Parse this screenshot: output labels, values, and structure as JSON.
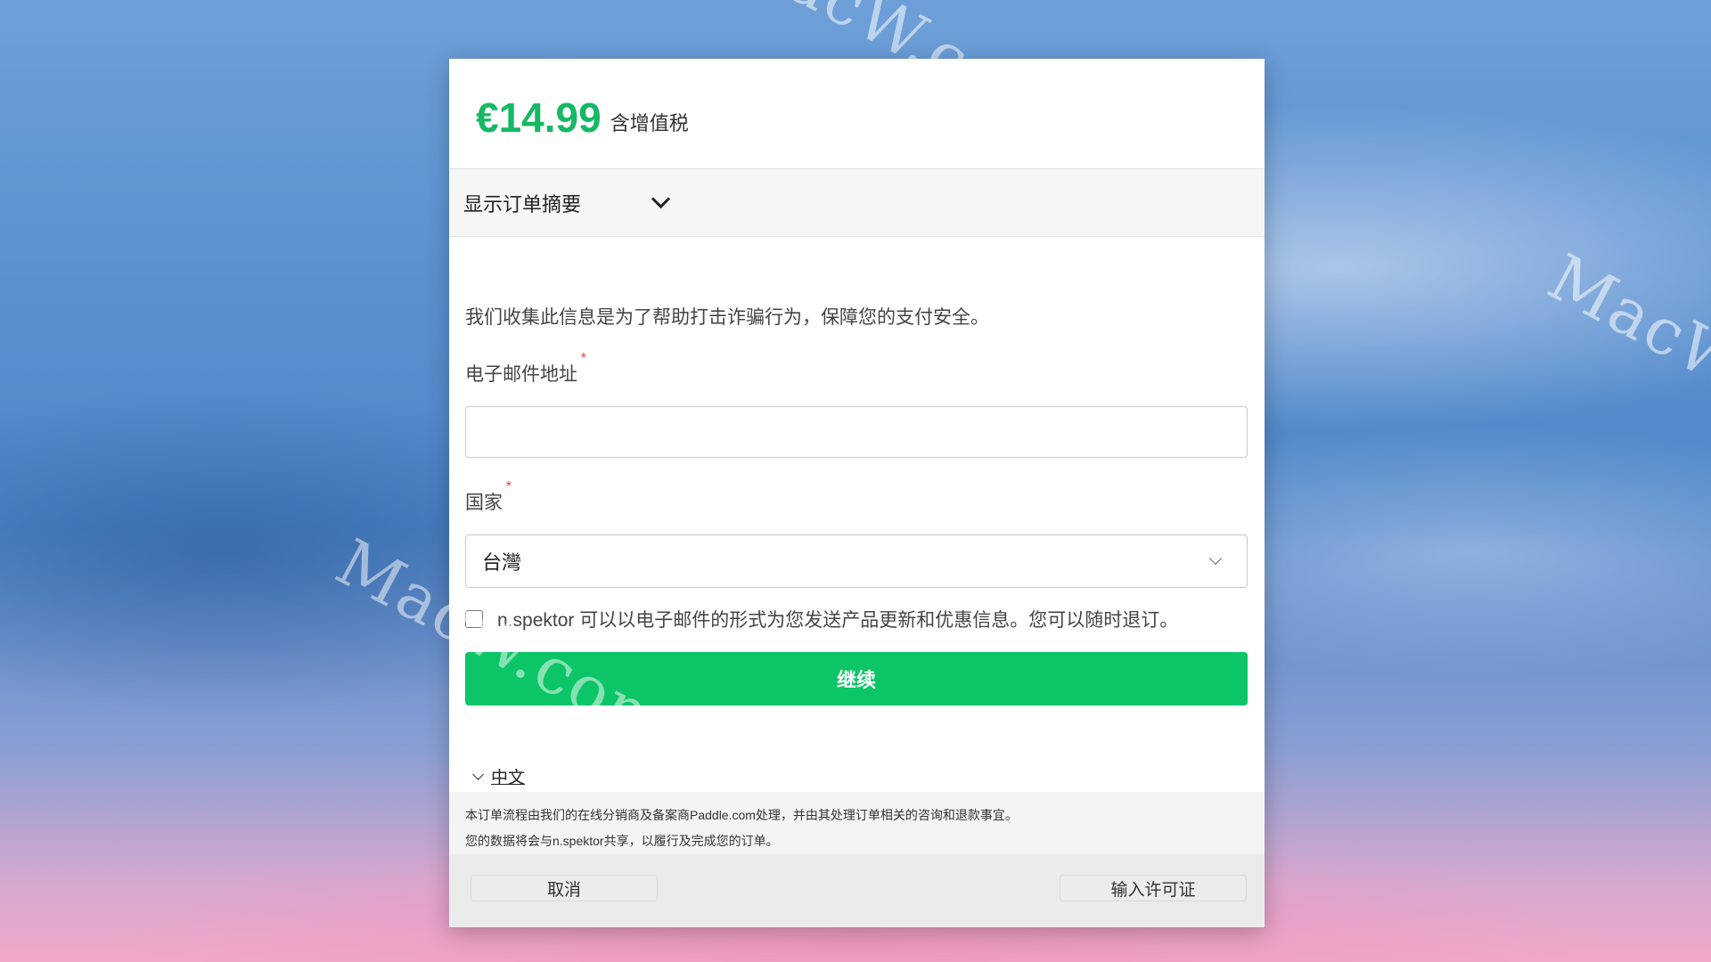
{
  "watermark": {
    "text": "MacW.com"
  },
  "price": {
    "amount": "€14.99",
    "vat_label": "含增值税"
  },
  "summary": {
    "label": "显示订单摘要"
  },
  "form": {
    "notice": "我们收集此信息是为了帮助打击诈骗行为，保障您的支付安全。",
    "email_label": "电子邮件地址",
    "email_value": "",
    "country_label": "国家",
    "country_value": "台灣",
    "required_mark": "*",
    "optin_text": "n.spektor 可以以电子邮件的形式为您发送产品更新和优惠信息。您可以随时退订。",
    "optin_checked": false,
    "continue_label": "继续"
  },
  "language": {
    "label": "中文"
  },
  "footer_note": {
    "line1": "本订单流程由我们的在线分销商及备案商Paddle.com处理，并由其处理订单相关的咨询和退款事宜。",
    "line2": "您的数据将会与n.spektor共享，以履行及完成您的订单。"
  },
  "bottom_bar": {
    "cancel_label": "取消",
    "license_label": "输入许可证"
  },
  "colors": {
    "accent": "#0cc567",
    "price": "#16b864",
    "required": "#e0433a"
  }
}
